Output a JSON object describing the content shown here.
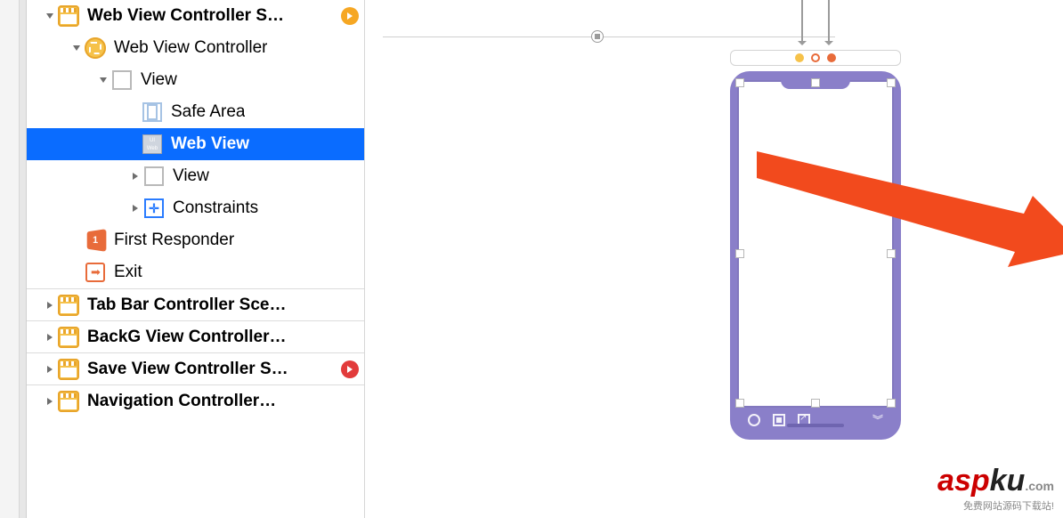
{
  "outline": {
    "scene": {
      "title": "Web View Controller S…",
      "vc": "Web View Controller",
      "view": "View",
      "safeArea": "Safe Area",
      "webView": "Web View",
      "innerView": "View",
      "constraints": "Constraints",
      "firstResponder": "First Responder",
      "exit": "Exit"
    },
    "scenes": [
      "Tab Bar Controller Sce…",
      "BackG View Controller…",
      "Save View Controller S…",
      "Navigation Controller…"
    ]
  },
  "webviewIconText": "UI Web View",
  "watermark": {
    "brand1": "asp",
    "brand2": "ku",
    "tld": ".com",
    "subtitle": "免费网站源码下载站!"
  }
}
